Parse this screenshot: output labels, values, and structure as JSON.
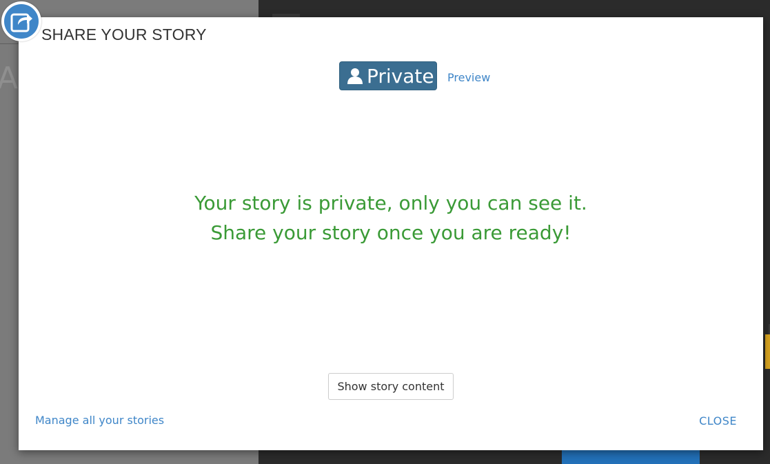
{
  "modal": {
    "title": "SHARE YOUR STORY",
    "status_label": "Private",
    "preview_label": "Preview",
    "message_line_1": "Your story is private, only you can see it.",
    "message_line_2": "Share your story once you are ready!",
    "show_content_label": "Show story content",
    "manage_label": "Manage all your stories",
    "close_label": "CLOSE"
  },
  "icons": {
    "corner": "share-icon",
    "status": "user-icon"
  },
  "colors": {
    "accent": "#3f86c8",
    "status_badge": "#3b6e91",
    "message": "#3a9a36",
    "title": "#333333"
  }
}
